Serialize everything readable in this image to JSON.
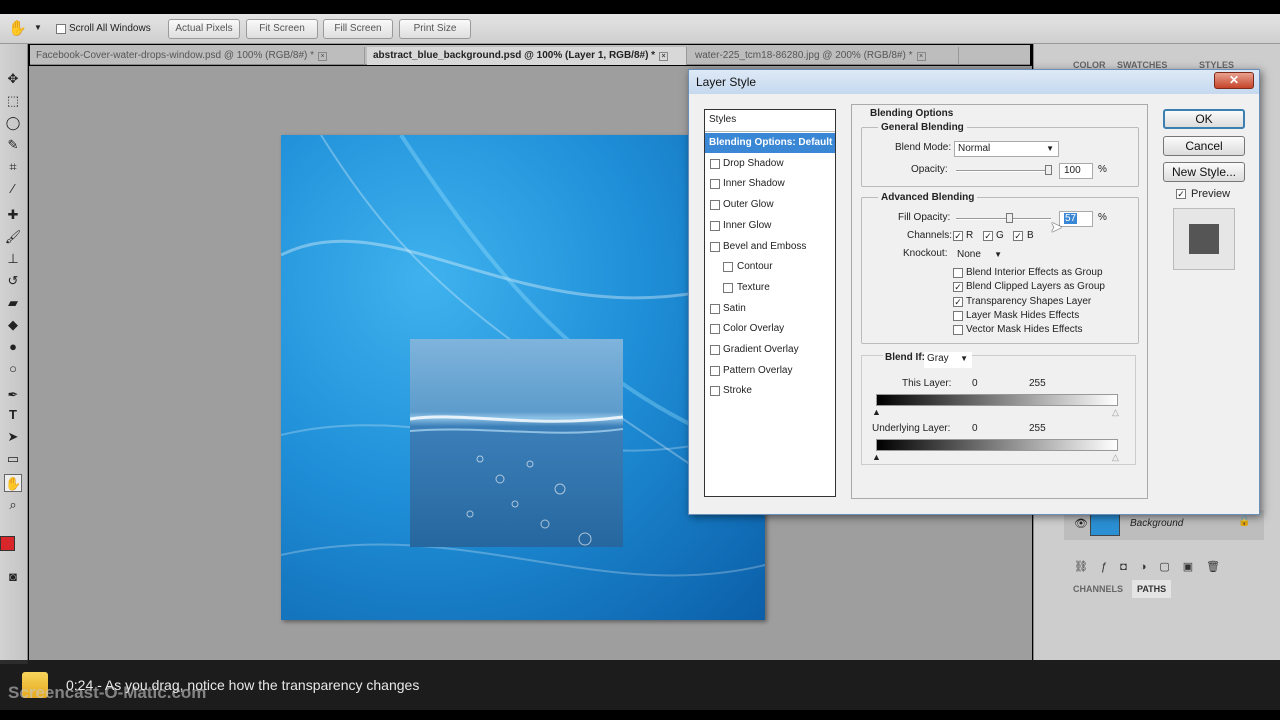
{
  "options_bar": {
    "scroll_all_windows": "Scroll All Windows",
    "buttons": [
      "Actual Pixels",
      "Fit Screen",
      "Fill Screen",
      "Print Size"
    ]
  },
  "doc_tabs": [
    "Facebook-Cover-water-drops-window.psd @ 100% (RGB/8#) *",
    "abstract_blue_background.psd @ 100% (Layer 1, RGB/8#) *",
    "water-225_tcm18-86280.jpg @ 200% (RGB/8#) *"
  ],
  "right_panel": {
    "top_tabs": [
      "COLOR",
      "SWATCHES",
      "STYLES"
    ],
    "layer_name": "Background",
    "bottom_tabs": [
      "CHANNELS",
      "PATHS"
    ]
  },
  "dialog": {
    "title": "Layer Style",
    "styles_header": "Styles",
    "styles": [
      {
        "label": "Blending Options: Default",
        "selected": true
      },
      {
        "label": "Drop Shadow"
      },
      {
        "label": "Inner Shadow"
      },
      {
        "label": "Outer Glow"
      },
      {
        "label": "Inner Glow"
      },
      {
        "label": "Bevel and Emboss"
      },
      {
        "label": "Contour",
        "sub": true
      },
      {
        "label": "Texture",
        "sub": true
      },
      {
        "label": "Satin"
      },
      {
        "label": "Color Overlay"
      },
      {
        "label": "Gradient Overlay"
      },
      {
        "label": "Pattern Overlay"
      },
      {
        "label": "Stroke"
      }
    ],
    "blending_options": "Blending Options",
    "general_blending": "General Blending",
    "blend_mode_label": "Blend Mode:",
    "blend_mode_value": "Normal",
    "opacity_label": "Opacity:",
    "opacity_value": "100",
    "percent": "%",
    "advanced_blending": "Advanced Blending",
    "fill_opacity_label": "Fill Opacity:",
    "fill_opacity_value": "57",
    "channels_label": "Channels:",
    "channels": [
      "R",
      "G",
      "B"
    ],
    "knockout_label": "Knockout:",
    "knockout_value": "None",
    "checks": [
      {
        "label": "Blend Interior Effects as Group",
        "checked": false
      },
      {
        "label": "Blend Clipped Layers as Group",
        "checked": true
      },
      {
        "label": "Transparency Shapes Layer",
        "checked": true
      },
      {
        "label": "Layer Mask Hides Effects",
        "checked": false
      },
      {
        "label": "Vector Mask Hides Effects",
        "checked": false
      }
    ],
    "blend_if_label": "Blend If:",
    "blend_if_value": "Gray",
    "this_layer_label": "This Layer:",
    "underlying_label": "Underlying Layer:",
    "range_min": "0",
    "range_max": "255",
    "buttons": {
      "ok": "OK",
      "cancel": "Cancel",
      "new_style": "New Style..."
    },
    "preview_label": "Preview"
  },
  "caption": {
    "text": "0:24 - As you drag, notice how the transparency changes",
    "watermark": "Screencast-O-Matic.com"
  }
}
